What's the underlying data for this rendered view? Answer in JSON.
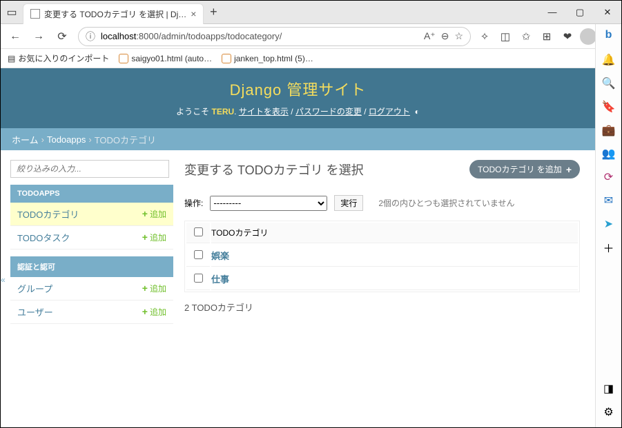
{
  "window": {
    "tab_title": "変更する TODOカテゴリ を選択 | Dj…"
  },
  "address_bar": {
    "host": "localhost",
    "path": ":8000/admin/todoapps/todocategory/"
  },
  "bookmarks": {
    "import": "お気に入りのインポート",
    "bm1": "saigyo01.html (auto…",
    "bm2": "janken_top.html (5)…"
  },
  "django": {
    "site_title": "Django 管理サイト",
    "welcome": "ようこそ",
    "username": "TERU",
    "view_site": "サイトを表示",
    "change_password": "パスワードの変更",
    "logout": "ログアウト"
  },
  "breadcrumbs": {
    "home": "ホーム",
    "app": "Todoapps",
    "current": "TODOカテゴリ"
  },
  "sidebar": {
    "filter_placeholder": "絞り込みの入力...",
    "app1": {
      "caption": "TODOAPPS",
      "items": [
        {
          "name": "TODOカテゴリ",
          "add": "追加"
        },
        {
          "name": "TODOタスク",
          "add": "追加"
        }
      ]
    },
    "app2": {
      "caption": "認証と認可",
      "items": [
        {
          "name": "グループ",
          "add": "追加"
        },
        {
          "name": "ユーザー",
          "add": "追加"
        }
      ]
    }
  },
  "main": {
    "title": "変更する TODOカテゴリ を選択",
    "add_button": "TODOカテゴリ を追加",
    "action_label": "操作:",
    "action_placeholder": "---------",
    "go_label": "実行",
    "selection_text": "2個の内ひとつも選択されていません",
    "col_header": "TODOカテゴリ",
    "rows": [
      {
        "name": "娯楽"
      },
      {
        "name": "仕事"
      }
    ],
    "count": "2 TODOカテゴリ"
  }
}
